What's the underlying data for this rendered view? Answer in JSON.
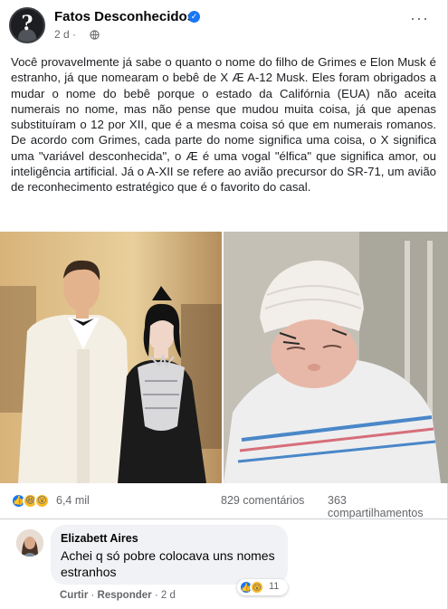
{
  "post": {
    "page_name": "Fatos Desconhecidos",
    "time": "2 d",
    "more_label": "···",
    "text": "Você provavelmente já sabe o quanto o nome do filho de Grimes e Elon Musk é estranho, já que nomearam o bebê de X Æ A-12 Musk. Eles foram obrigados a mudar o nome do bebê porque o estado da Califórnia (EUA) não aceita numerais no nome, mas não pense que mudou muita coisa, já que apenas substituíram o 12 por XII, que é a mesma coisa só que em numerais romanos. De acordo com Grimes, cada parte do nome significa uma coisa, o X significa uma \"variável desconhecida\", o Æ é uma vogal \"élfica\" que significa amor, ou inteligência artificial. Já o A-XII se refere ao avião precursor do SR-71, um avião de reconhecimento estratégico que é o favorito do casal."
  },
  "stats": {
    "reactions_count": "6,4 mil",
    "comments": "829 comentários",
    "shares": "363 compartilhamentos"
  },
  "comment": {
    "author": "Elizabett Aires",
    "text": "Achei q só pobre colocava uns nomes estranhos",
    "reactions_count": "11",
    "like_label": "Curtir",
    "reply_label": "Responder",
    "time": "2 d"
  },
  "colors": {
    "accent": "#1877f2",
    "secondary_text": "#65676b",
    "bubble": "#f0f2f5"
  }
}
